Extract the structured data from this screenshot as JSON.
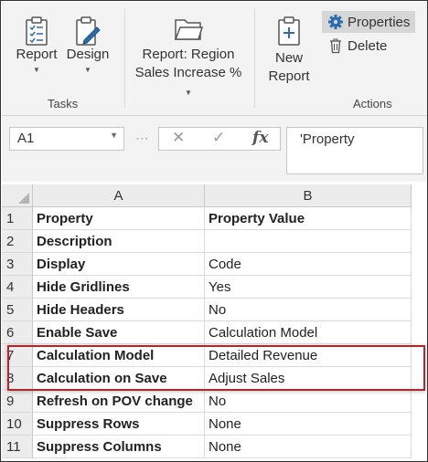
{
  "ribbon": {
    "report_label": "Report",
    "design_label": "Design",
    "report_region_line1": "Report: Region",
    "report_region_line2": "Sales Increase %",
    "new_report_line1": "New",
    "new_report_line2": "Report",
    "properties_label": "Properties",
    "delete_label": "Delete",
    "tasks_group": "Tasks",
    "actions_group": "Actions",
    "icons": [
      "report-clipboard-icon",
      "design-pencil-icon",
      "folder-icon",
      "new-report-icon",
      "gear-icon",
      "trash-icon"
    ]
  },
  "formula_bar": {
    "name_box": "A1",
    "cancel_symbol": "✕",
    "enter_symbol": "✓",
    "fx_symbol": "fx",
    "formula_value": "'Property"
  },
  "sheet": {
    "columns": [
      "A",
      "B"
    ],
    "rows": [
      {
        "num": "1",
        "a": "Property",
        "b": "Property Value",
        "header": true
      },
      {
        "num": "2",
        "a": "Description",
        "b": ""
      },
      {
        "num": "3",
        "a": "Display",
        "b": "Code"
      },
      {
        "num": "4",
        "a": "Hide Gridlines",
        "b": "Yes"
      },
      {
        "num": "5",
        "a": "Hide Headers",
        "b": "No"
      },
      {
        "num": "6",
        "a": "Enable Save",
        "b": "Calculation Model"
      },
      {
        "num": "7",
        "a": "Calculation Model",
        "b": "Detailed Revenue"
      },
      {
        "num": "8",
        "a": "Calculation on Save",
        "b": "Adjust Sales"
      },
      {
        "num": "9",
        "a": "Refresh on POV change",
        "b": "No"
      },
      {
        "num": "10",
        "a": "Suppress Rows",
        "b": "None"
      },
      {
        "num": "11",
        "a": "Suppress Columns",
        "b": "None"
      }
    ]
  },
  "colors": {
    "highlight_border": "#b4252b",
    "icon_blue": "#2b6cb0",
    "ribbon_bg": "#f3f3f3"
  }
}
